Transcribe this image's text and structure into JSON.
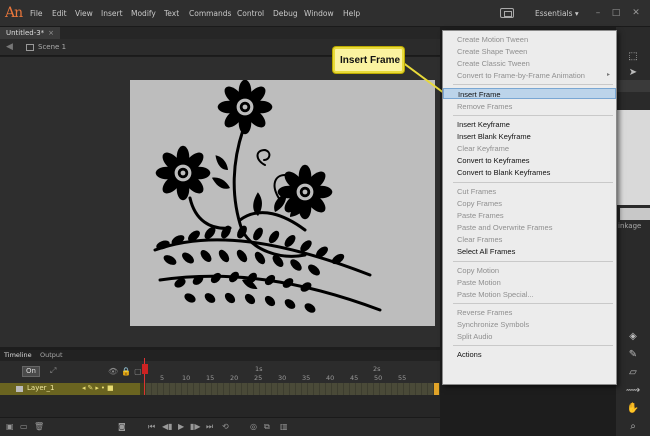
{
  "app": {
    "logo": "An"
  },
  "menubar": {
    "items": [
      "File",
      "Edit",
      "View",
      "Insert",
      "Modify",
      "Text",
      "Commands",
      "Control",
      "Debug",
      "Window",
      "Help"
    ],
    "workspace": "Essentials ▾",
    "window_buttons": [
      "–",
      "□",
      "✕"
    ]
  },
  "document": {
    "tab_title": "Untitled-3*",
    "close": "×",
    "scene": "Scene 1"
  },
  "callout": {
    "label": "Insert Frame"
  },
  "context_menu": {
    "items": [
      {
        "label": "Create Motion Tween",
        "state": "disabled"
      },
      {
        "label": "Create Shape Tween",
        "state": "disabled"
      },
      {
        "label": "Create Classic Tween",
        "state": "disabled"
      },
      {
        "label": "Convert to Frame-by-Frame Animation",
        "state": "disabled",
        "submenu": "▸"
      },
      {
        "label": "Insert Frame",
        "state": "highlighted"
      },
      {
        "label": "Remove Frames",
        "state": "disabled"
      },
      {
        "label": "Insert Keyframe",
        "state": "enabled"
      },
      {
        "label": "Insert Blank Keyframe",
        "state": "enabled"
      },
      {
        "label": "Clear Keyframe",
        "state": "disabled"
      },
      {
        "label": "Convert to Keyframes",
        "state": "enabled"
      },
      {
        "label": "Convert to Blank Keyframes",
        "state": "enabled"
      },
      {
        "label": "Cut Frames",
        "state": "disabled"
      },
      {
        "label": "Copy Frames",
        "state": "disabled"
      },
      {
        "label": "Paste Frames",
        "state": "disabled"
      },
      {
        "label": "Paste and Overwrite Frames",
        "state": "disabled"
      },
      {
        "label": "Clear Frames",
        "state": "disabled"
      },
      {
        "label": "Select All Frames",
        "state": "enabled"
      },
      {
        "label": "Copy Motion",
        "state": "disabled"
      },
      {
        "label": "Paste Motion",
        "state": "disabled"
      },
      {
        "label": "Paste Motion Special...",
        "state": "disabled"
      },
      {
        "label": "Reverse Frames",
        "state": "disabled"
      },
      {
        "label": "Synchronize Symbols",
        "state": "disabled"
      },
      {
        "label": "Split Audio",
        "state": "disabled"
      },
      {
        "label": "Actions",
        "state": "enabled"
      }
    ]
  },
  "timeline": {
    "tabs": [
      "Timeline",
      "Output"
    ],
    "onion_label": "On",
    "ruler_seconds": [
      "1s",
      "2s"
    ],
    "ruler_frames": [
      "5",
      "10",
      "15",
      "20",
      "25",
      "30",
      "35",
      "40",
      "45",
      "50",
      "55"
    ],
    "layer": {
      "name": "Layer_1"
    }
  },
  "right_panel": {
    "linkage_label": "inkage"
  },
  "colors": {
    "menu_highlight": "#bcd4ea",
    "callout_fill": "#fbf3a0",
    "callout_border": "#e8da3a",
    "layer_row": "#6a6420",
    "playhead": "#d33333",
    "logo": "#e8763b"
  }
}
